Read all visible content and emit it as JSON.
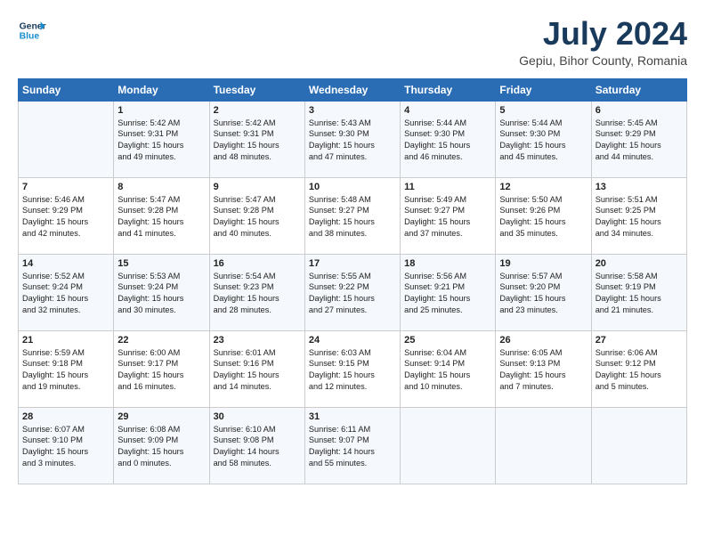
{
  "logo": {
    "line1": "General",
    "line2": "Blue"
  },
  "title": "July 2024",
  "subtitle": "Gepiu, Bihor County, Romania",
  "headers": [
    "Sunday",
    "Monday",
    "Tuesday",
    "Wednesday",
    "Thursday",
    "Friday",
    "Saturday"
  ],
  "weeks": [
    [
      {
        "day": "",
        "text": ""
      },
      {
        "day": "1",
        "text": "Sunrise: 5:42 AM\nSunset: 9:31 PM\nDaylight: 15 hours\nand 49 minutes."
      },
      {
        "day": "2",
        "text": "Sunrise: 5:42 AM\nSunset: 9:31 PM\nDaylight: 15 hours\nand 48 minutes."
      },
      {
        "day": "3",
        "text": "Sunrise: 5:43 AM\nSunset: 9:30 PM\nDaylight: 15 hours\nand 47 minutes."
      },
      {
        "day": "4",
        "text": "Sunrise: 5:44 AM\nSunset: 9:30 PM\nDaylight: 15 hours\nand 46 minutes."
      },
      {
        "day": "5",
        "text": "Sunrise: 5:44 AM\nSunset: 9:30 PM\nDaylight: 15 hours\nand 45 minutes."
      },
      {
        "day": "6",
        "text": "Sunrise: 5:45 AM\nSunset: 9:29 PM\nDaylight: 15 hours\nand 44 minutes."
      }
    ],
    [
      {
        "day": "7",
        "text": "Sunrise: 5:46 AM\nSunset: 9:29 PM\nDaylight: 15 hours\nand 42 minutes."
      },
      {
        "day": "8",
        "text": "Sunrise: 5:47 AM\nSunset: 9:28 PM\nDaylight: 15 hours\nand 41 minutes."
      },
      {
        "day": "9",
        "text": "Sunrise: 5:47 AM\nSunset: 9:28 PM\nDaylight: 15 hours\nand 40 minutes."
      },
      {
        "day": "10",
        "text": "Sunrise: 5:48 AM\nSunset: 9:27 PM\nDaylight: 15 hours\nand 38 minutes."
      },
      {
        "day": "11",
        "text": "Sunrise: 5:49 AM\nSunset: 9:27 PM\nDaylight: 15 hours\nand 37 minutes."
      },
      {
        "day": "12",
        "text": "Sunrise: 5:50 AM\nSunset: 9:26 PM\nDaylight: 15 hours\nand 35 minutes."
      },
      {
        "day": "13",
        "text": "Sunrise: 5:51 AM\nSunset: 9:25 PM\nDaylight: 15 hours\nand 34 minutes."
      }
    ],
    [
      {
        "day": "14",
        "text": "Sunrise: 5:52 AM\nSunset: 9:24 PM\nDaylight: 15 hours\nand 32 minutes."
      },
      {
        "day": "15",
        "text": "Sunrise: 5:53 AM\nSunset: 9:24 PM\nDaylight: 15 hours\nand 30 minutes."
      },
      {
        "day": "16",
        "text": "Sunrise: 5:54 AM\nSunset: 9:23 PM\nDaylight: 15 hours\nand 28 minutes."
      },
      {
        "day": "17",
        "text": "Sunrise: 5:55 AM\nSunset: 9:22 PM\nDaylight: 15 hours\nand 27 minutes."
      },
      {
        "day": "18",
        "text": "Sunrise: 5:56 AM\nSunset: 9:21 PM\nDaylight: 15 hours\nand 25 minutes."
      },
      {
        "day": "19",
        "text": "Sunrise: 5:57 AM\nSunset: 9:20 PM\nDaylight: 15 hours\nand 23 minutes."
      },
      {
        "day": "20",
        "text": "Sunrise: 5:58 AM\nSunset: 9:19 PM\nDaylight: 15 hours\nand 21 minutes."
      }
    ],
    [
      {
        "day": "21",
        "text": "Sunrise: 5:59 AM\nSunset: 9:18 PM\nDaylight: 15 hours\nand 19 minutes."
      },
      {
        "day": "22",
        "text": "Sunrise: 6:00 AM\nSunset: 9:17 PM\nDaylight: 15 hours\nand 16 minutes."
      },
      {
        "day": "23",
        "text": "Sunrise: 6:01 AM\nSunset: 9:16 PM\nDaylight: 15 hours\nand 14 minutes."
      },
      {
        "day": "24",
        "text": "Sunrise: 6:03 AM\nSunset: 9:15 PM\nDaylight: 15 hours\nand 12 minutes."
      },
      {
        "day": "25",
        "text": "Sunrise: 6:04 AM\nSunset: 9:14 PM\nDaylight: 15 hours\nand 10 minutes."
      },
      {
        "day": "26",
        "text": "Sunrise: 6:05 AM\nSunset: 9:13 PM\nDaylight: 15 hours\nand 7 minutes."
      },
      {
        "day": "27",
        "text": "Sunrise: 6:06 AM\nSunset: 9:12 PM\nDaylight: 15 hours\nand 5 minutes."
      }
    ],
    [
      {
        "day": "28",
        "text": "Sunrise: 6:07 AM\nSunset: 9:10 PM\nDaylight: 15 hours\nand 3 minutes."
      },
      {
        "day": "29",
        "text": "Sunrise: 6:08 AM\nSunset: 9:09 PM\nDaylight: 15 hours\nand 0 minutes."
      },
      {
        "day": "30",
        "text": "Sunrise: 6:10 AM\nSunset: 9:08 PM\nDaylight: 14 hours\nand 58 minutes."
      },
      {
        "day": "31",
        "text": "Sunrise: 6:11 AM\nSunset: 9:07 PM\nDaylight: 14 hours\nand 55 minutes."
      },
      {
        "day": "",
        "text": ""
      },
      {
        "day": "",
        "text": ""
      },
      {
        "day": "",
        "text": ""
      }
    ]
  ]
}
